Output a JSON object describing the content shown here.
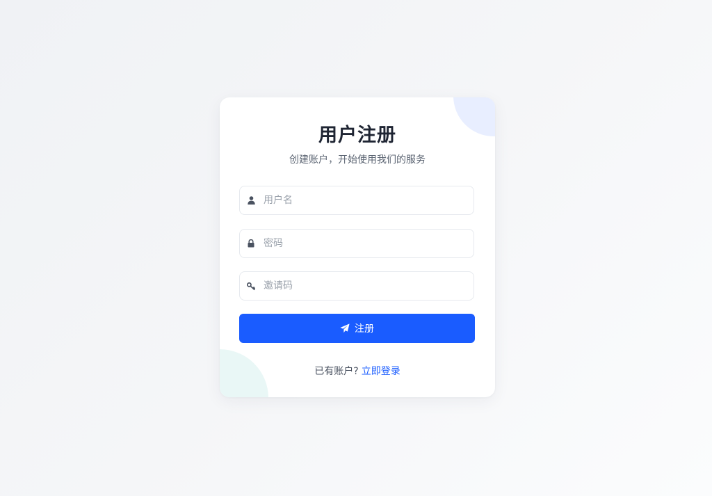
{
  "register": {
    "title": "用户注册",
    "subtitle": "创建账户，开始使用我们的服务",
    "fields": {
      "username": {
        "placeholder": "用户名",
        "value": "",
        "icon": "user-icon"
      },
      "password": {
        "placeholder": "密码",
        "value": "",
        "icon": "lock-icon"
      },
      "invite_code": {
        "placeholder": "邀请码",
        "value": "",
        "icon": "key-icon"
      }
    },
    "submit": {
      "label": "注册",
      "icon": "paper-plane-icon"
    },
    "footer": {
      "prompt": "已有账户?",
      "login_link": "立即登录"
    }
  },
  "colors": {
    "accent": "#1a5cff",
    "title": "#1f2533",
    "muted": "#5b6472",
    "deco_top": "#e8eeff",
    "deco_bottom": "#e9f7f6"
  }
}
